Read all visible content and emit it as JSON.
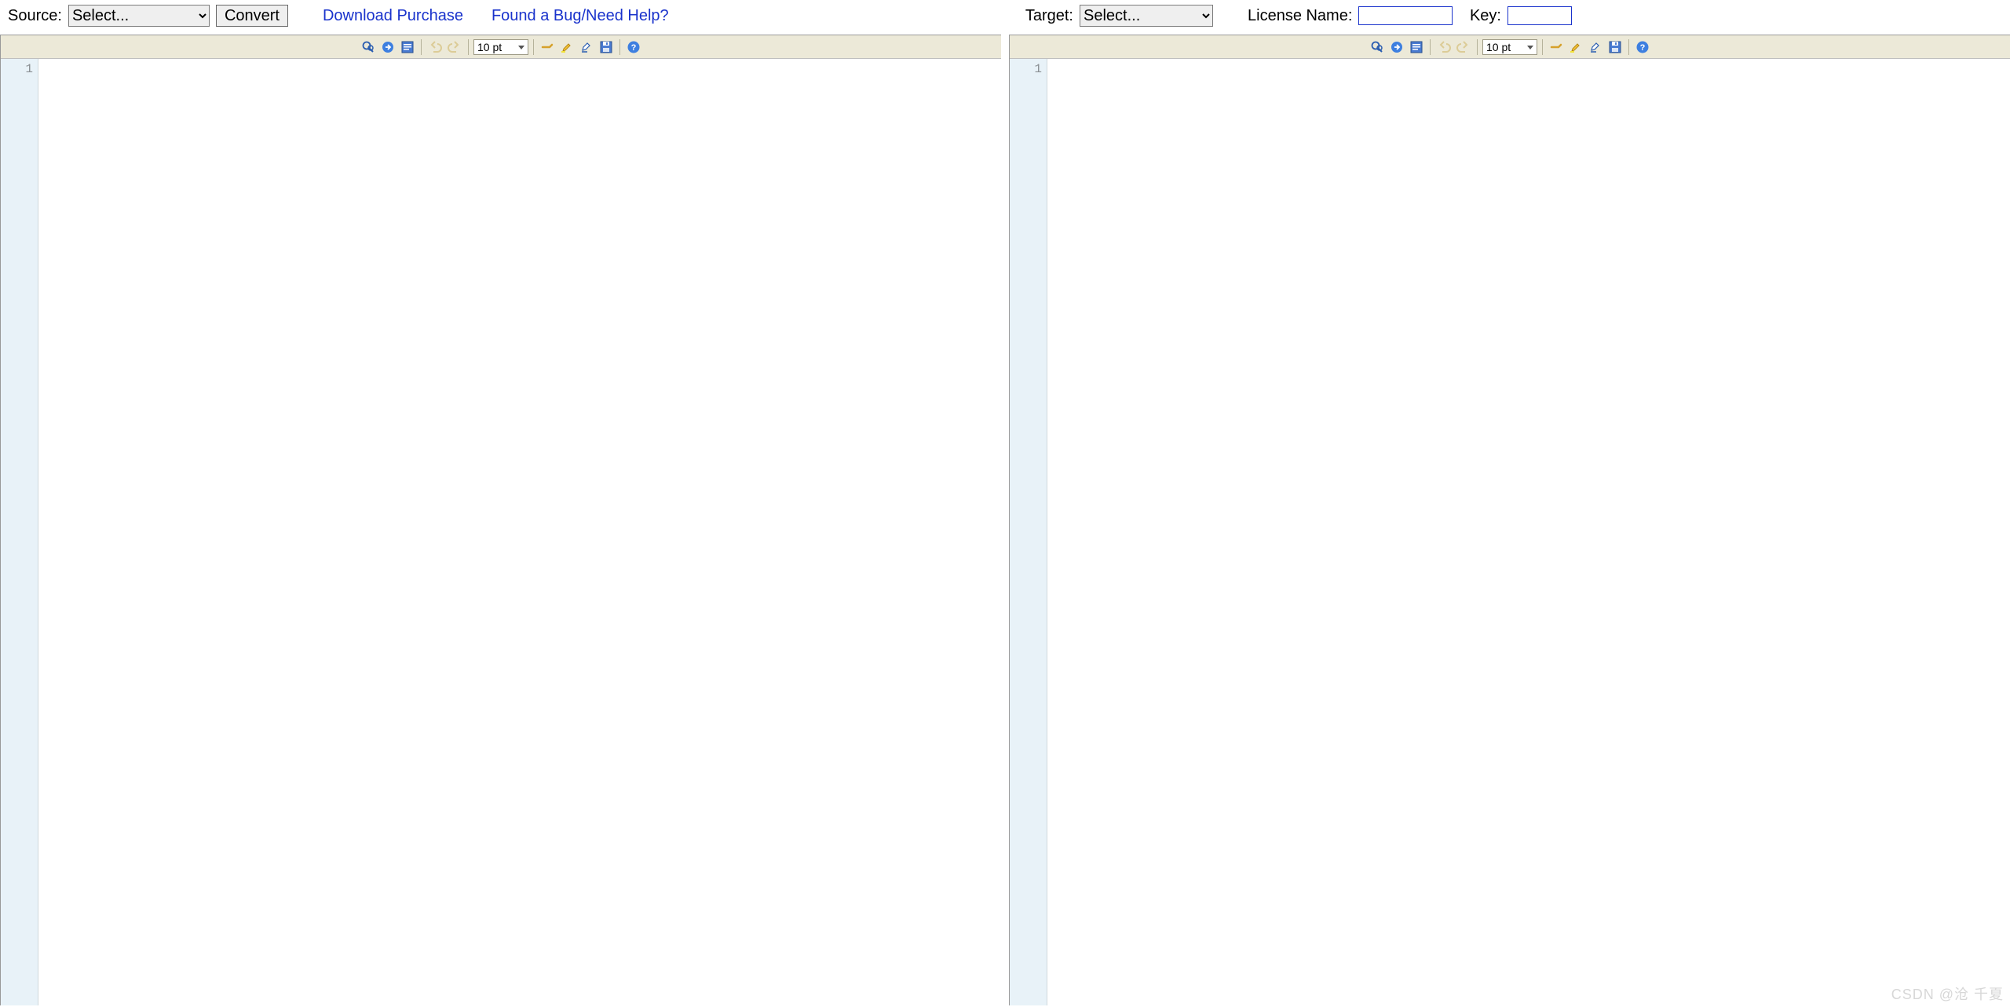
{
  "topbar": {
    "source_label": "Source:",
    "source_placeholder": "Select...",
    "convert_label": "Convert",
    "download_label": "Download Purchase",
    "bug_label": "Found a Bug/Need Help?",
    "target_label": "Target:",
    "target_placeholder": "Select...",
    "license_label": "License Name:",
    "key_label": "Key:",
    "license_value": "",
    "key_value": ""
  },
  "toolbar": {
    "font_size": "10 pt"
  },
  "editor": {
    "line_number": "1"
  },
  "watermark": "CSDN @沧 千夏"
}
